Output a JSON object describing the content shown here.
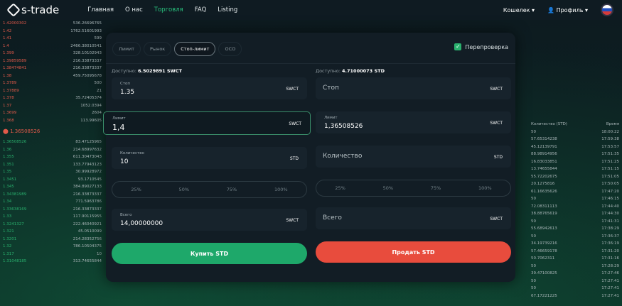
{
  "nav": {
    "logo": "s-trade",
    "menu": [
      "Главная",
      "О нас",
      "Торговля",
      "FAQ",
      "Listing"
    ],
    "wallet": "Кошелек",
    "profile": "Профиль"
  },
  "left_book": [
    [
      "1.42000302",
      "536.26696765"
    ],
    [
      "1.42",
      "1762.51601993"
    ],
    [
      "1.41",
      "599"
    ],
    [
      "1.4",
      "2466.38010541"
    ],
    [
      "1.399",
      "328.10102943"
    ],
    [
      "1.39859589",
      "216.33873337"
    ],
    [
      "1.38474841",
      "216.33873337"
    ],
    [
      "1.38",
      "459.75095678"
    ],
    [
      "1.3789",
      "500"
    ],
    [
      "1.37889",
      "21"
    ],
    [
      "1.378",
      "35.72405374"
    ],
    [
      "1.37",
      "1052.0394"
    ],
    [
      "1.3699",
      "2604"
    ],
    [
      "1.368",
      "113.99605"
    ]
  ],
  "mid_price": "1.36508526",
  "left_bids": [
    [
      "1.36508526",
      "83.47125965"
    ],
    [
      "1.36",
      "214.68997632"
    ],
    [
      "1.355",
      "611.30473043"
    ],
    [
      "1.351",
      "133.77943123"
    ],
    [
      "1.35",
      "30.99928972"
    ],
    [
      "1.3451",
      "93.1710545"
    ],
    [
      "1.345",
      "384.89027133"
    ],
    [
      "1.34381989",
      "216.33873337"
    ],
    [
      "1.34",
      "771.5963786"
    ],
    [
      "1.33638169",
      "216.33873337"
    ],
    [
      "1.33",
      "117.90115955"
    ],
    [
      "1.3241327",
      "222.46040921"
    ],
    [
      "1.321",
      "45.0510099"
    ],
    [
      "1.3201",
      "214.28352756"
    ],
    [
      "1.32",
      "786.10504375"
    ],
    [
      "1.317",
      "10"
    ],
    [
      "1.31048185",
      "313.74655844"
    ]
  ],
  "right_header": [
    "Количество (STD)",
    "Время"
  ],
  "right_rows": [
    [
      "50",
      "18:00:22"
    ],
    [
      "57.65314238",
      "17:59:38"
    ],
    [
      "45.12139791",
      "17:53:57"
    ],
    [
      "88.98914956",
      "17:51:35"
    ],
    [
      "16.83033851",
      "17:51:25"
    ],
    [
      "13.74655844",
      "17:51:15"
    ],
    [
      "55.72202675",
      "17:51:05"
    ],
    [
      "20.1275816",
      "17:50:05"
    ],
    [
      "61.16635626",
      "17:47:20"
    ],
    [
      "50",
      "17:46:15"
    ],
    [
      "72.08311113",
      "17:44:40"
    ],
    [
      "38.88765619",
      "17:44:30"
    ],
    [
      "50",
      "17:41:31"
    ],
    [
      "55.68942613",
      "17:38:29"
    ],
    [
      "50",
      "17:36:37"
    ],
    [
      "34.19739216",
      "17:36:19"
    ],
    [
      "57.46659178",
      "17:31:20"
    ],
    [
      "50.7062311",
      "17:31:16"
    ],
    [
      "50",
      "17:28:29"
    ],
    [
      "39.47100825",
      "17:27:46"
    ],
    [
      "50",
      "17:27:41"
    ],
    [
      "50",
      "17:27:41"
    ],
    [
      "67.17221225",
      "17:27:41"
    ]
  ],
  "right_red": [
    "1.36508526",
    "1.36508526",
    "1.36508577"
  ],
  "left_bottom": [
    "1037.65865775",
    "13.17",
    "411.15917033"
  ],
  "modal": {
    "tabs": [
      "Лимит",
      "Рынок",
      "Стоп-лимит",
      "OCO"
    ],
    "recheck": "Перепроверка",
    "buy": {
      "avail_label": "Доступно:",
      "avail_value": "6.5029891 SWCT",
      "stop_label": "Стоп",
      "stop_value": "1.35",
      "stop_unit": "SWCT",
      "limit_label": "Лимит",
      "limit_value": "1,4",
      "limit_unit": "SWCT",
      "qty_label": "Количество",
      "qty_value": "10",
      "qty_unit": "STD",
      "total_label": "Всего",
      "total_value": "14,00000000",
      "total_unit": "SWCT",
      "button": "Купить STD"
    },
    "sell": {
      "avail_label": "Доступно:",
      "avail_value": "4.71000073 STD",
      "stop_ph": "Стоп",
      "stop_unit": "SWCT",
      "limit_label": "Лимит",
      "limit_value": "1,36508526",
      "limit_unit": "SWCT",
      "qty_ph": "Количество",
      "qty_unit": "STD",
      "total_ph": "Всего",
      "total_unit": "SWCT",
      "button": "Продать STD"
    },
    "percents": [
      "25%",
      "50%",
      "75%",
      "100%"
    ]
  }
}
